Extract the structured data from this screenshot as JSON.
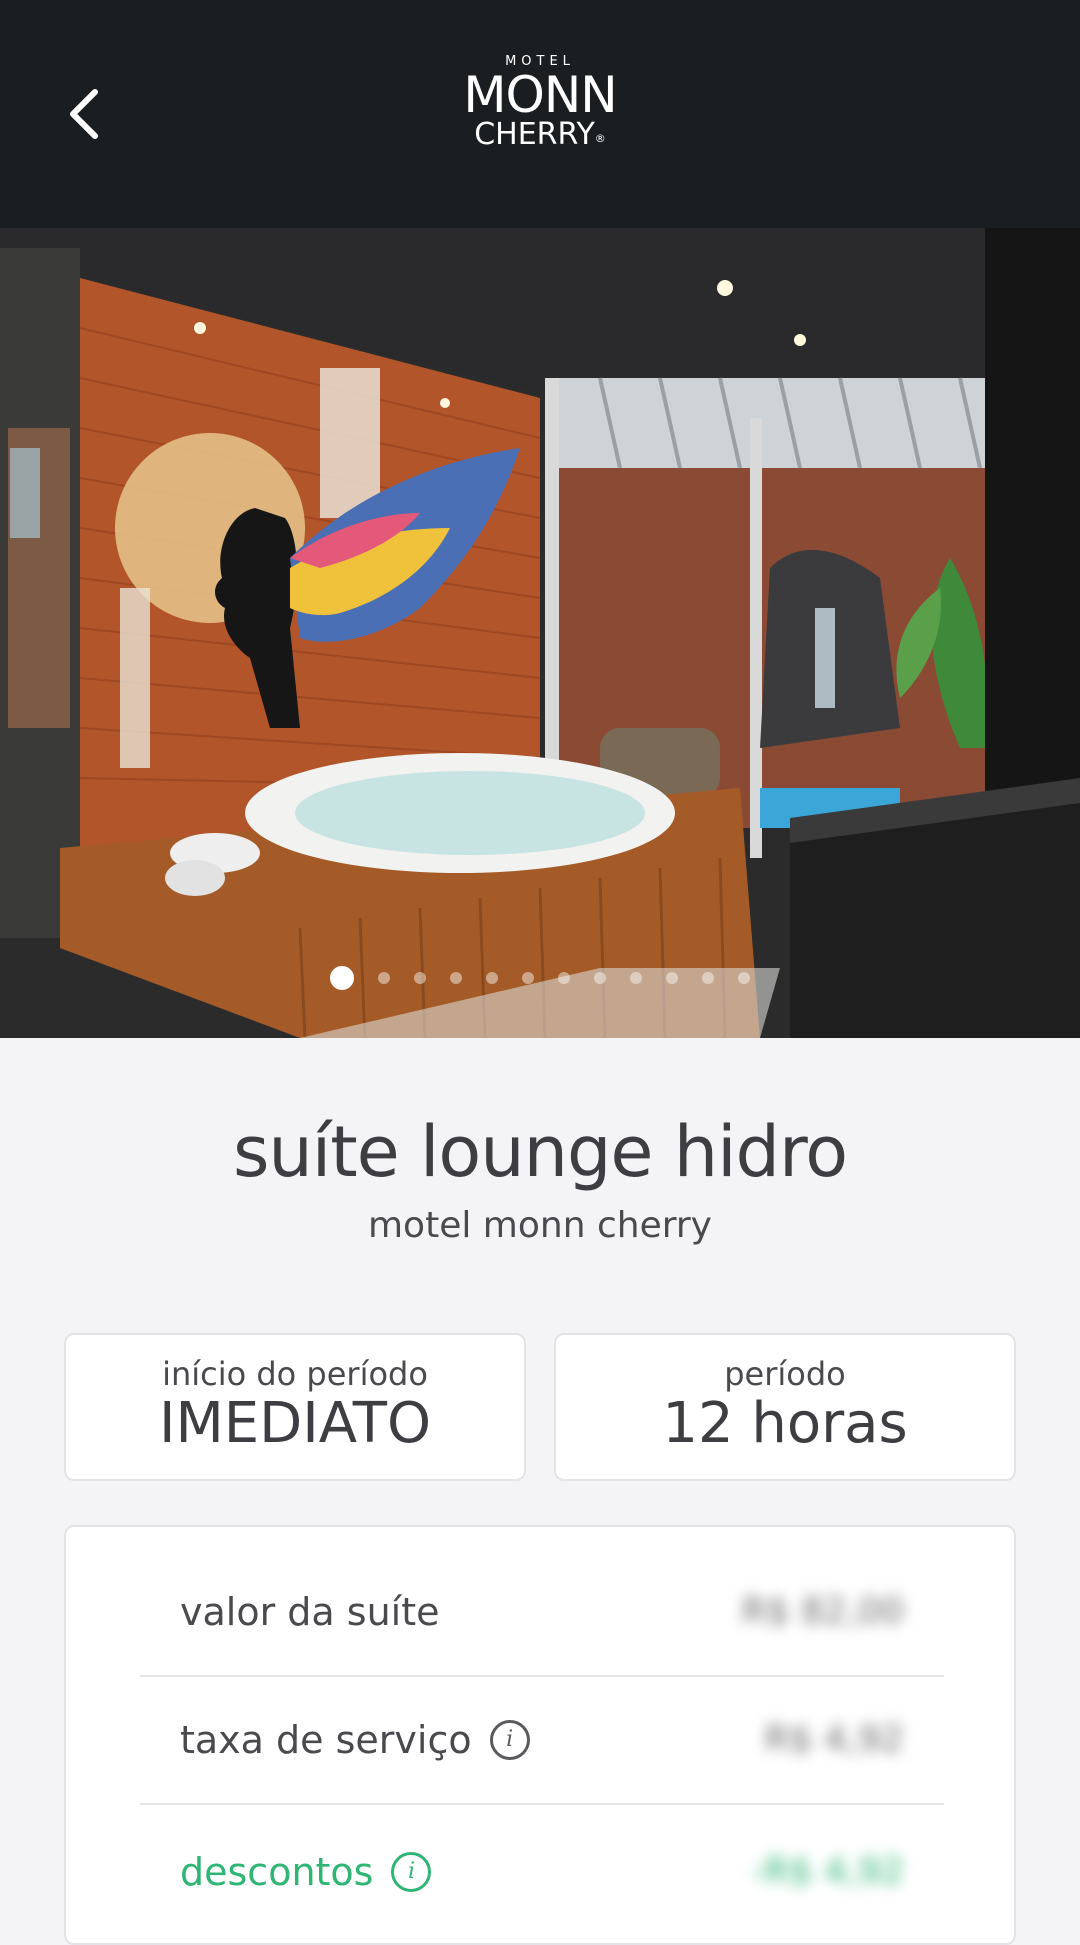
{
  "header": {
    "back_icon": "chevron-left-icon",
    "logo_line1": "MOTEL",
    "logo_line2": "MONN",
    "logo_line3": "CHERRY",
    "logo_reg": "®"
  },
  "gallery": {
    "image": "suite-photo",
    "slide_count": 12,
    "active_index": 0
  },
  "suite": {
    "name": "suíte lounge hidro",
    "motel": "motel monn cherry"
  },
  "booking": {
    "start_label": "início do período",
    "start_value": "IMEDIATO",
    "period_label": "período",
    "period_value": "12 horas"
  },
  "prices": {
    "rows": [
      {
        "label": "valor da suíte",
        "value": "R$ 82,00",
        "info": false
      },
      {
        "label": "taxa de serviço",
        "value": "R$ 4,92",
        "info": true
      },
      {
        "label": "descontos",
        "value": "-R$ 4,92",
        "info": true
      }
    ]
  },
  "colors": {
    "header_bg": "#1b1e20",
    "page_bg": "#f4f4f7",
    "text": "#3e3e42",
    "discount_green": "#2fb574"
  }
}
